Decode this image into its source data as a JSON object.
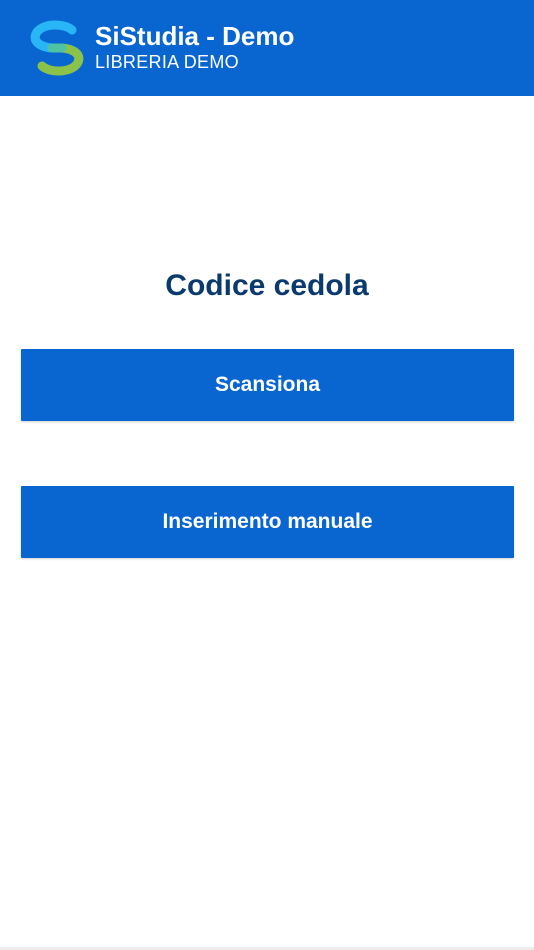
{
  "header": {
    "title": "SiStudia - Demo",
    "subtitle": "LIBRERIA DEMO",
    "logo_icon": "sistudia-logo-icon",
    "background_color": "#0966d1"
  },
  "main": {
    "title": "Codice cedola",
    "title_color": "#0b3a6e",
    "buttons": {
      "scan_label": "Scansiona",
      "manual_label": "Inserimento manuale"
    },
    "button_color": "#0966d1"
  }
}
